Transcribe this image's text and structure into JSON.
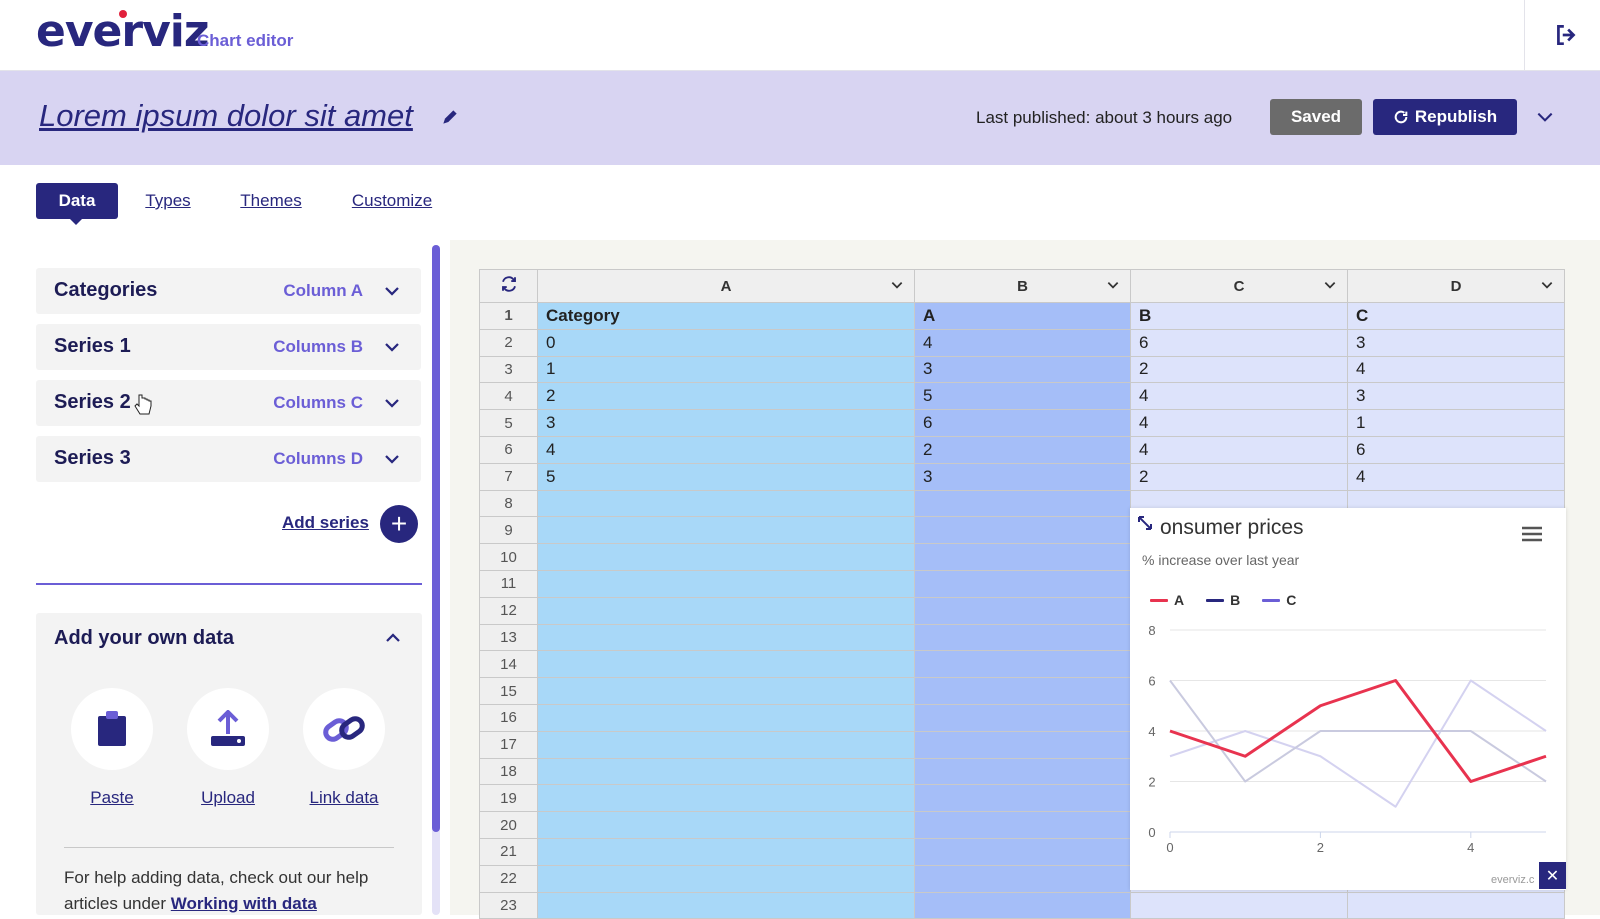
{
  "header": {
    "logo": "everviz",
    "subtitle": "Chart editor"
  },
  "titlebar": {
    "title": "Lorem ipsum dolor sit amet",
    "last_published": "Last published: about 3 hours ago",
    "saved_label": "Saved",
    "republish_label": "Republish"
  },
  "tabs": [
    {
      "label": "Data",
      "active": true
    },
    {
      "label": "Types",
      "active": false
    },
    {
      "label": "Themes",
      "active": false
    },
    {
      "label": "Customize",
      "active": false
    }
  ],
  "series_panel": {
    "items": [
      {
        "title": "Categories",
        "column": "Column A"
      },
      {
        "title": "Series 1",
        "column": "Columns B"
      },
      {
        "title": "Series 2",
        "column": "Columns C"
      },
      {
        "title": "Series 3",
        "column": "Columns D"
      }
    ],
    "add_series_label": "Add series"
  },
  "own_data": {
    "title": "Add your own data",
    "options": [
      "Paste",
      "Upload",
      "Link data"
    ],
    "help_text": "For help adding data, check out our help articles under ",
    "help_link": "Working with data"
  },
  "grid": {
    "columns": [
      "A",
      "B",
      "C",
      "D"
    ],
    "rows": [
      [
        "1",
        "Category",
        "A",
        "B",
        "C"
      ],
      [
        "2",
        "0",
        "4",
        "6",
        "3"
      ],
      [
        "3",
        "1",
        "3",
        "2",
        "4"
      ],
      [
        "4",
        "2",
        "5",
        "4",
        "3"
      ],
      [
        "5",
        "3",
        "6",
        "4",
        "1"
      ],
      [
        "6",
        "4",
        "2",
        "4",
        "6"
      ],
      [
        "7",
        "5",
        "3",
        "2",
        "4"
      ],
      [
        "8",
        "",
        "",
        "",
        ""
      ],
      [
        "9",
        "",
        "",
        "",
        ""
      ],
      [
        "10",
        "",
        "",
        "",
        ""
      ],
      [
        "11",
        "",
        "",
        "",
        ""
      ],
      [
        "12",
        "",
        "",
        "",
        ""
      ],
      [
        "13",
        "",
        "",
        "",
        ""
      ],
      [
        "14",
        "",
        "",
        "",
        ""
      ],
      [
        "15",
        "",
        "",
        "",
        ""
      ],
      [
        "16",
        "",
        "",
        "",
        ""
      ],
      [
        "17",
        "",
        "",
        "",
        ""
      ],
      [
        "18",
        "",
        "",
        "",
        ""
      ],
      [
        "19",
        "",
        "",
        "",
        ""
      ],
      [
        "20",
        "",
        "",
        "",
        ""
      ],
      [
        "21",
        "",
        "",
        "",
        ""
      ],
      [
        "22",
        "",
        "",
        "",
        ""
      ],
      [
        "23",
        "",
        "",
        "",
        ""
      ]
    ]
  },
  "chart_data": {
    "type": "line",
    "title": "onsumer prices",
    "subtitle": "% increase over last year",
    "x": [
      0,
      1,
      2,
      3,
      4,
      5
    ],
    "x_ticks": [
      "0",
      "2",
      "4"
    ],
    "y_ticks": [
      "0",
      "2",
      "4",
      "6",
      "8"
    ],
    "ylim": [
      0,
      8
    ],
    "xlim": [
      0,
      5
    ],
    "grid": true,
    "legend": "top-left",
    "series": [
      {
        "name": "A",
        "values": [
          4,
          3,
          5,
          6,
          2,
          3
        ],
        "color": "#e8334f"
      },
      {
        "name": "B",
        "values": [
          6,
          2,
          4,
          4,
          4,
          2
        ],
        "color": "#c9cadf"
      },
      {
        "name": "C",
        "values": [
          3,
          4,
          3,
          1,
          6,
          4
        ],
        "color": "#d4d2f0"
      }
    ],
    "legend_colors": [
      "#e8334f",
      "#28277e",
      "#6b5ed6"
    ],
    "credit": "everviz.c"
  },
  "colors": {
    "brand": "#28277e",
    "accent": "#6b5ed6",
    "band": "#d8d4f2",
    "logo_dot": "#e1213c"
  }
}
